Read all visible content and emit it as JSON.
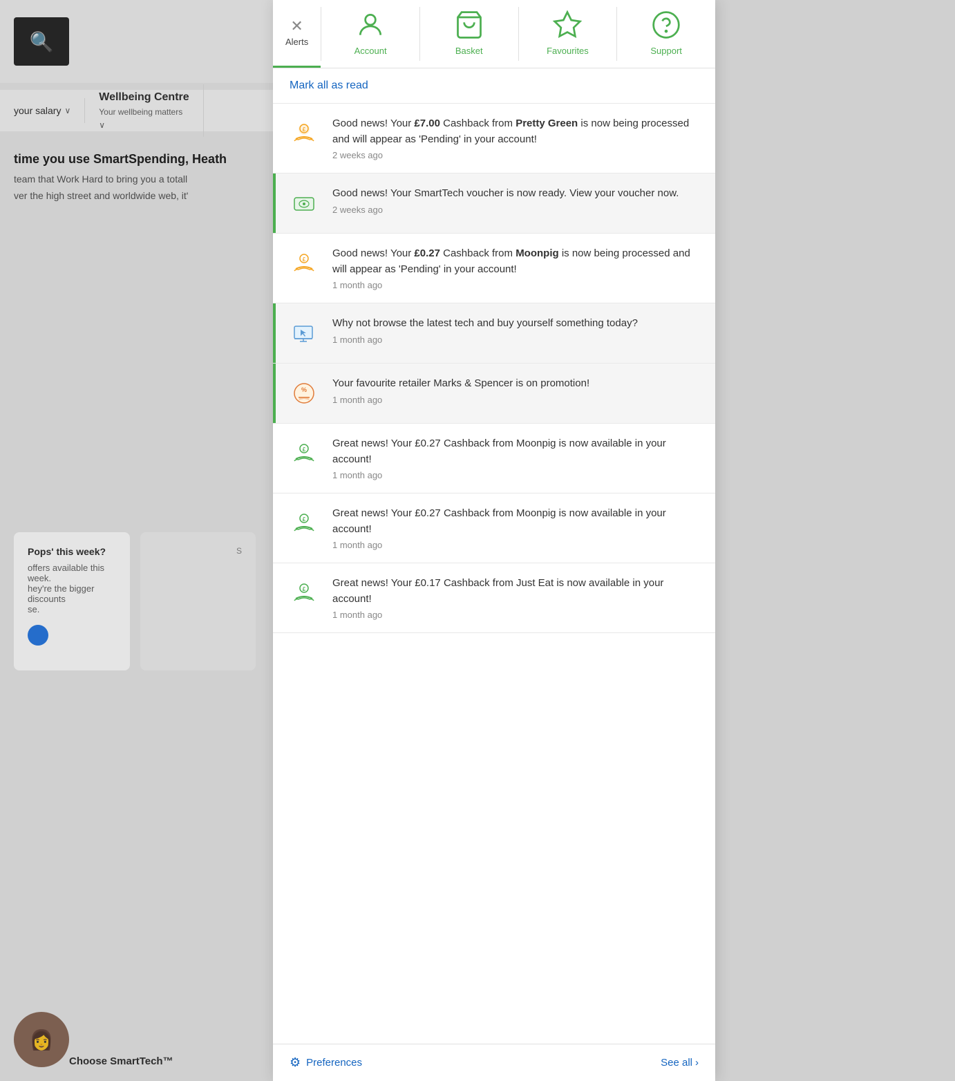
{
  "background": {
    "search_placeholder": "Search",
    "nav_salary": "your salary",
    "nav_wellbeing": "Wellbeing Centre",
    "nav_wellbeing_sub": "Your wellbeing matters",
    "smartspending_text": "time you use SmartSpending, Heath",
    "team_text": "team that Work Hard to bring you a totall",
    "highstreet_text": "ver the high street and worldwide web, it'",
    "pops_text": "Pops' this week?",
    "offers_text": "offers available this week.",
    "bigger_text": "hey're the bigger discounts",
    "se_text": "se.",
    "avatar_initial": "👤",
    "choose_smarttech": "Choose SmartTech™"
  },
  "tabs": [
    {
      "id": "alerts",
      "label": "Alerts",
      "icon": "✕",
      "icon_type": "close",
      "active": true
    },
    {
      "id": "account",
      "label": "Account",
      "icon": "👤",
      "icon_type": "person",
      "active": false
    },
    {
      "id": "basket",
      "label": "Basket",
      "icon": "🧺",
      "icon_type": "basket",
      "active": false
    },
    {
      "id": "favourites",
      "label": "Favourites",
      "icon": "☆",
      "icon_type": "star",
      "active": false
    },
    {
      "id": "support",
      "label": "Support",
      "icon": "?",
      "icon_type": "help",
      "active": false
    }
  ],
  "mark_all_read": "Mark all as read",
  "notifications": [
    {
      "id": 1,
      "icon_type": "cashback-orange",
      "text_parts": [
        {
          "text": "Good news! Your ",
          "bold": false
        },
        {
          "text": "£7.00",
          "bold": true
        },
        {
          "text": " Cashback from ",
          "bold": false
        },
        {
          "text": "Pretty Green",
          "bold": true
        },
        {
          "text": " is now being processed and will appear as 'Pending' in your account!",
          "bold": false
        }
      ],
      "text": "Good news! Your £7.00 Cashback from Pretty Green is now being processed and will appear as 'Pending' in your account!",
      "time": "2 weeks ago",
      "unread": false
    },
    {
      "id": 2,
      "icon_type": "voucher",
      "text": "Good news! Your SmartTech voucher is now ready. View your voucher now.",
      "time": "2 weeks ago",
      "unread": true
    },
    {
      "id": 3,
      "icon_type": "cashback-orange",
      "text_parts": [
        {
          "text": "Good news! Your ",
          "bold": false
        },
        {
          "text": "£0.27",
          "bold": true
        },
        {
          "text": " Cashback from ",
          "bold": false
        },
        {
          "text": "Moonpig",
          "bold": true
        },
        {
          "text": " is now being processed and will appear as 'Pending' in your account!",
          "bold": false
        }
      ],
      "text": "Good news! Your £0.27 Cashback from Moonpig is now being processed and will appear as 'Pending' in your account!",
      "time": "1 month ago",
      "unread": false
    },
    {
      "id": 4,
      "icon_type": "tech",
      "text": "Why not browse the latest tech and buy yourself something today?",
      "time": "1 month ago",
      "unread": true
    },
    {
      "id": 5,
      "icon_type": "promo",
      "text": "Your favourite retailer Marks & Spencer is on promotion!",
      "time": "1 month ago",
      "unread": true
    },
    {
      "id": 6,
      "icon_type": "cashback-green",
      "text_parts": [
        {
          "text": "Great news! Your £0.27 Cashback from Moonpig is now available in your account!",
          "bold": false
        }
      ],
      "text": "Great news! Your £0.27 Cashback from Moonpig is now available in your account!",
      "time": "1 month ago",
      "unread": false
    },
    {
      "id": 7,
      "icon_type": "cashback-green",
      "text": "Great news! Your £0.27 Cashback from Moonpig is now available in your account!",
      "time": "1 month ago",
      "unread": false
    },
    {
      "id": 8,
      "icon_type": "cashback-green",
      "text": "Great news! Your £0.17 Cashback from Just Eat is now available in your account!",
      "time": "1 month ago",
      "unread": false
    }
  ],
  "footer": {
    "preferences_label": "Preferences",
    "see_all_label": "See all",
    "see_all_arrow": "›"
  }
}
